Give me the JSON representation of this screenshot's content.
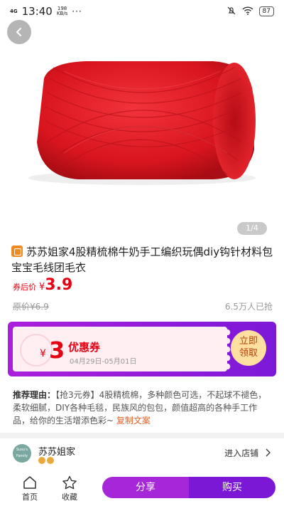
{
  "status_bar": {
    "network": "4G",
    "time": "13:40",
    "speed_value": "198",
    "speed_unit": "KB/s",
    "dots": "···",
    "battery": "87"
  },
  "gallery": {
    "page_indicator": "1/4"
  },
  "product": {
    "title": "苏苏姐家4股精梳棉牛奶手工编织玩偶diy钩针材料包宝宝毛线团毛衣",
    "price_label": "券后价",
    "currency": "¥",
    "price": "3.9",
    "original_label": "原价",
    "original_price": "¥6.9",
    "sold": "6.5万人已抢"
  },
  "coupon": {
    "currency": "¥",
    "amount": "3",
    "name": "优惠券",
    "valid_dates": "04月29日-05月01日",
    "claim_line1": "立即",
    "claim_line2": "领取"
  },
  "recommend": {
    "label": "推荐理由：",
    "text": "【抢3元券】4股精梳棉，多种颜色可选，不起球不褪色，柔软细腻，DIY各种毛毯，民族风的包包，颜值超高的各种手工作品，给你的生活增添色彩~",
    "copy_link": "复制文案"
  },
  "shop": {
    "name": "苏苏姐家",
    "enter": "进入店铺"
  },
  "bottom_bar": {
    "home": "首页",
    "favorite": "收藏",
    "share": "分享",
    "buy": "购买"
  },
  "colors": {
    "price_red": "#e60012",
    "coupon_purple": "#a01fdc",
    "button_purple": "#7a18d6"
  }
}
